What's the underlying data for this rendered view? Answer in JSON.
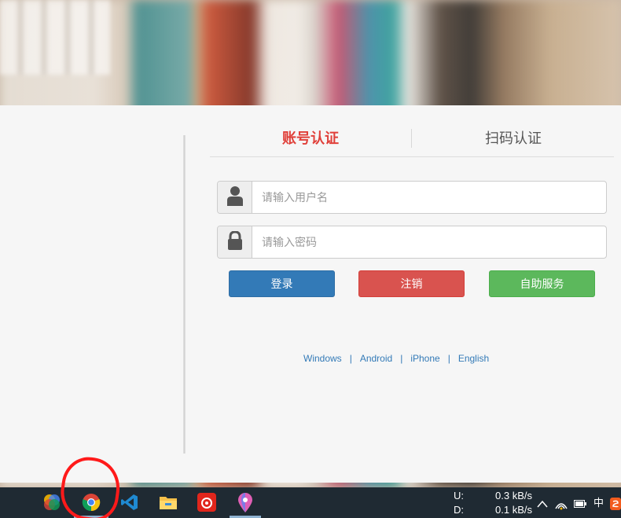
{
  "login": {
    "tabs": [
      {
        "label": "账号认证",
        "active": true
      },
      {
        "label": "扫码认证",
        "active": false
      }
    ],
    "username": {
      "placeholder": "请输入用户名",
      "value": "",
      "icon": "user-icon"
    },
    "password": {
      "placeholder": "请输入密码",
      "value": "",
      "icon": "lock-icon"
    },
    "buttons": {
      "login": "登录",
      "cancel": "注销",
      "self_service": "自助服务"
    },
    "links": [
      "Windows",
      "Android",
      "iPhone",
      "English"
    ],
    "link_separator": "|"
  },
  "taskbar": {
    "apps": [
      {
        "name": "photos-icon"
      },
      {
        "name": "chrome-icon",
        "active": true
      },
      {
        "name": "vscode-icon"
      },
      {
        "name": "file-explorer-icon"
      },
      {
        "name": "netease-music-icon"
      },
      {
        "name": "maps-icon",
        "active": true
      }
    ],
    "network": {
      "upload_label": "U:",
      "upload_value": "0.3 kB/s",
      "download_label": "D:",
      "download_value": "0.1 kB/s"
    },
    "tray": {
      "ime": "中"
    }
  },
  "colors": {
    "active_tab": "#e0403a",
    "login_button": "#337ab7",
    "cancel_button": "#d9534f",
    "self_service_button": "#5cb85c",
    "link": "#337ab7",
    "taskbar": "#1f2a33",
    "annotation": "#ff1a1a"
  }
}
